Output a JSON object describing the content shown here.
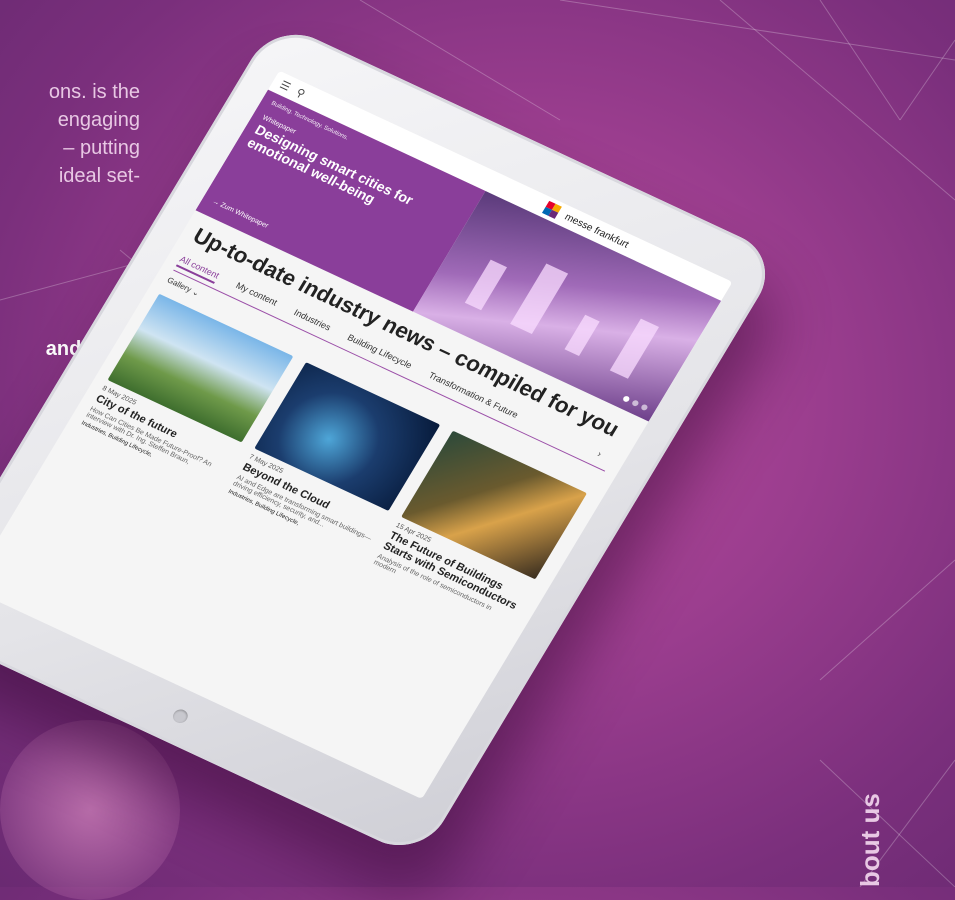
{
  "background": {
    "text_lines": [
      "ons. is the",
      "engaging",
      "– putting",
      "ideal set-"
    ],
    "bold_text": "and help",
    "side_text": "bout us",
    "accent_color": "#9a3d8e"
  },
  "app": {
    "topbar": {
      "menu_icon": "menu-icon",
      "search_icon": "search-icon"
    },
    "brand_name": "messe frankfurt",
    "language": "EN",
    "hero": {
      "tagline": "Building. Technology. Solutions.",
      "label": "Whitepaper",
      "title": "Designing smart cities for emotional well-being",
      "cta": "Zum Whitepaper"
    },
    "headline": "Up-to-date industry news – compiled for you",
    "tabs": [
      "All content",
      "My content",
      "Industries",
      "Building Lifecycle",
      "Transformation & Future"
    ],
    "filter_label": "Gallery",
    "cards": [
      {
        "date": "8 May 2025",
        "title": "City of the future",
        "excerpt": "How Can Cities Be Made Future-Proof? An interview with Dr. Ing. Steffen Braun,",
        "tags": "Industries, Building Lifecycle,"
      },
      {
        "date": "7 May 2025",
        "title": "Beyond the Cloud",
        "excerpt": "AI and Edge are transforming smart buildings—driving efficiency, security, and...",
        "tags": "Industries, Building Lifecycle,"
      },
      {
        "date": "15 Apr 2025",
        "title": "The Future of Buildings Starts with Semiconductors",
        "excerpt": "Analysis of the role of semiconductors in modern",
        "tags": ""
      }
    ]
  }
}
